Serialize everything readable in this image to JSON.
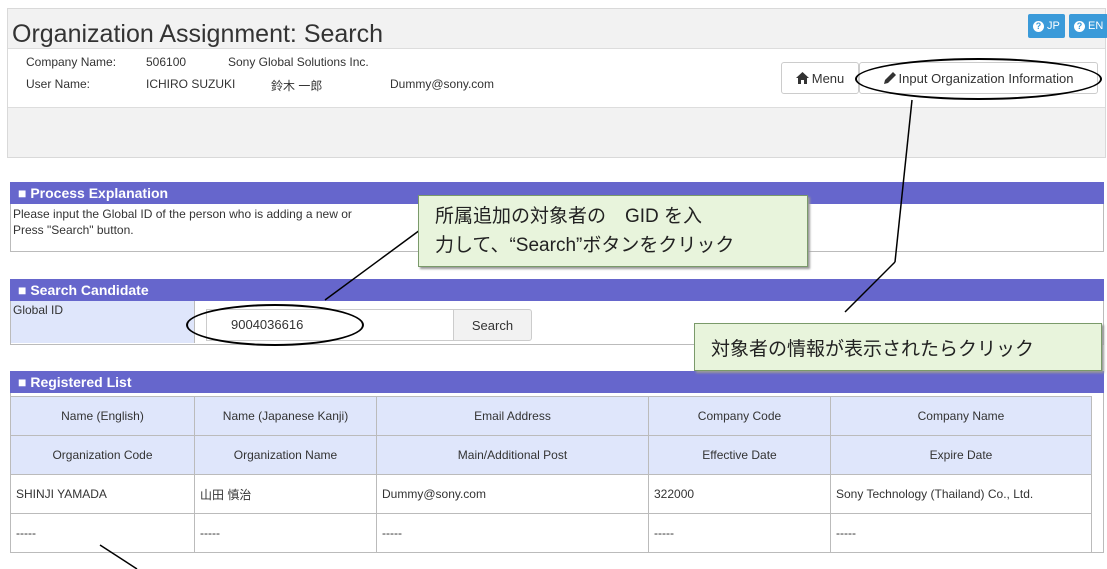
{
  "header": {
    "title": "Organization Assignment: Search",
    "lang_jp": "JP",
    "lang_en": "EN"
  },
  "user_info": {
    "company_name_label": "Company Name:",
    "company_code": "506100",
    "company_name": "Sony Global Solutions Inc.",
    "user_name_label": "User Name:",
    "user_name_en": "ICHIRO SUZUKI",
    "user_name_jp": "鈴木 一郎",
    "email": "Dummy@sony.com"
  },
  "toolbar": {
    "menu_label": "Menu",
    "input_org_label": "Input Organization Information"
  },
  "process": {
    "title": "■ Process Explanation",
    "line1": "Please input the Global ID of the person who is adding a new or",
    "line2": "Press \"Search\" button."
  },
  "search": {
    "title": "■ Search Candidate",
    "gid_label": "Global ID",
    "gid_value": "9004036616",
    "search_label": "Search"
  },
  "registered": {
    "title": "■ Registered List",
    "header_row1": [
      "Name (English)",
      "Name (Japanese Kanji)",
      "Email Address",
      "Company Code",
      "Company Name"
    ],
    "header_row2": [
      "Organization Code",
      "Organization Name",
      "Main/Additional Post",
      "Effective Date",
      "Expire Date"
    ],
    "row1": [
      "SHINJI YAMADA",
      "山田 慎治",
      "Dummy@sony.com",
      "322000",
      "Sony Technology (Thailand) Co., Ltd."
    ],
    "row2": [
      "-----",
      "-----",
      "-----",
      "-----",
      "-----"
    ]
  },
  "callouts": {
    "gid_line1": "所属追加の対象者の　GID を入",
    "gid_line2": "力して、“Search”ボタンをクリック",
    "click_note": "対象者の情報が表示されたらクリック"
  },
  "colors": {
    "section_header": "#6666cc",
    "table_header": "#dfe6fb",
    "lang_badge": "#3a9ad9",
    "callout_bg": "#e8f4dc"
  }
}
